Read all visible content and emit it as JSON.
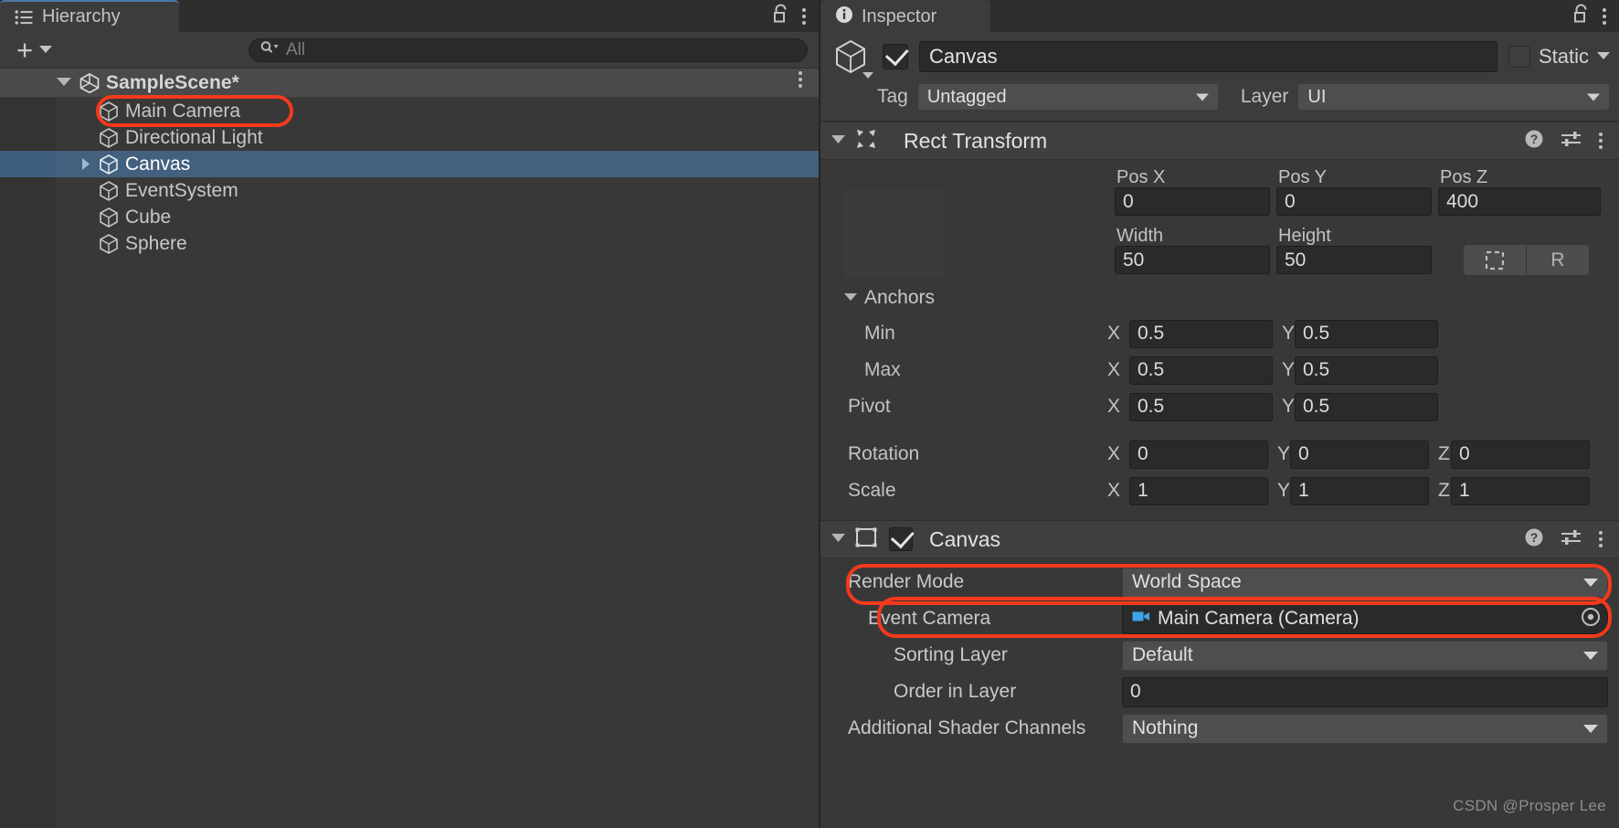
{
  "hierarchy": {
    "tab_label": "Hierarchy",
    "tab_icon": "hierarchy-list-icon",
    "lock_icon": "lock-open-icon",
    "menu_icon": "kebab-menu-icon",
    "create_button_label": "+",
    "search": {
      "placeholder": "All",
      "value": "",
      "icon": "search-icon"
    },
    "scene": {
      "name": "SampleScene*",
      "icon": "unity-scene-icon",
      "expanded": true
    },
    "items": [
      {
        "label": "Main Camera",
        "icon": "gameobject-cube-icon",
        "selected": false,
        "expandable": false,
        "highlighted": true
      },
      {
        "label": "Directional Light",
        "icon": "gameobject-cube-icon",
        "selected": false,
        "expandable": false,
        "highlighted": false
      },
      {
        "label": "Canvas",
        "icon": "gameobject-cube-icon",
        "selected": true,
        "expandable": true,
        "highlighted": false
      },
      {
        "label": "EventSystem",
        "icon": "gameobject-cube-icon",
        "selected": false,
        "expandable": false,
        "highlighted": false
      },
      {
        "label": "Cube",
        "icon": "gameobject-cube-icon",
        "selected": false,
        "expandable": false,
        "highlighted": false
      },
      {
        "label": "Sphere",
        "icon": "gameobject-cube-icon",
        "selected": false,
        "expandable": false,
        "highlighted": false
      }
    ]
  },
  "inspector": {
    "tab_label": "Inspector",
    "tab_icon": "info-circle-icon",
    "lock_icon": "lock-open-icon",
    "menu_icon": "kebab-menu-icon",
    "object": {
      "enabled": true,
      "name": "Canvas",
      "icon": "gameobject-cube-icon",
      "static_label": "Static",
      "static_checked": false,
      "tag_label": "Tag",
      "tag_value": "Untagged",
      "layer_label": "Layer",
      "layer_value": "UI"
    },
    "rect_transform": {
      "title": "Rect Transform",
      "icon": "rect-transform-icon",
      "expanded": true,
      "help_icon": "help-question-icon",
      "preset_icon": "preset-sliders-icon",
      "menu_icon": "kebab-menu-icon",
      "pos_x_label": "Pos X",
      "pos_x": "0",
      "pos_y_label": "Pos Y",
      "pos_y": "0",
      "pos_z_label": "Pos Z",
      "pos_z": "400",
      "width_label": "Width",
      "width": "50",
      "height_label": "Height",
      "height": "50",
      "blueprint_button_icon": "dashed-rect-icon",
      "raw_button_label": "R",
      "anchors_label": "Anchors",
      "min_label": "Min",
      "min_x": "0.5",
      "min_y": "0.5",
      "max_label": "Max",
      "max_x": "0.5",
      "max_y": "0.5",
      "pivot_label": "Pivot",
      "pivot_x": "0.5",
      "pivot_y": "0.5",
      "rotation_label": "Rotation",
      "rot_x": "0",
      "rot_y": "0",
      "rot_z": "0",
      "scale_label": "Scale",
      "scale_x": "1",
      "scale_y": "1",
      "scale_z": "1",
      "axis_x": "X",
      "axis_y": "Y",
      "axis_z": "Z"
    },
    "canvas": {
      "title": "Canvas",
      "icon": "canvas-component-icon",
      "enabled": true,
      "expanded": true,
      "help_icon": "help-question-icon",
      "preset_icon": "preset-sliders-icon",
      "menu_icon": "kebab-menu-icon",
      "render_mode_label": "Render Mode",
      "render_mode_value": "World Space",
      "event_camera_label": "Event Camera",
      "event_camera_value": "Main Camera (Camera)",
      "event_camera_icon": "camera-icon",
      "event_camera_picker_icon": "object-picker-target-icon",
      "sorting_layer_label": "Sorting Layer",
      "sorting_layer_value": "Default",
      "order_in_layer_label": "Order in Layer",
      "order_in_layer_value": "0",
      "additional_shader_channels_label": "Additional Shader Channels",
      "additional_shader_channels_value": "Nothing"
    }
  },
  "watermark": "CSDN @Prosper Lee",
  "colors": {
    "highlight_outline": "#f4391c",
    "selection_blue": "#43617f",
    "tab_accent": "#4a78a8",
    "panel_bg": "#383838",
    "header_bg": "#3c3c3c",
    "field_bg": "#2a2a2a",
    "dropdown_bg": "#4e4e4e"
  }
}
